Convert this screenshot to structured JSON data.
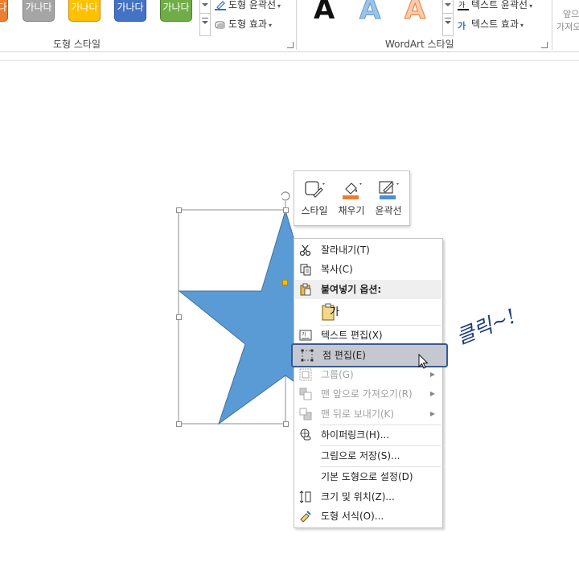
{
  "ribbon": {
    "shape_styles": {
      "swatch_text": "가나다",
      "outline_label": "도형 윤곽선",
      "effects_label": "도형 효과",
      "group_label": "도형 스타일"
    },
    "wordart_styles": {
      "letter": "A",
      "text_outline_label": "텍스트 윤곽선",
      "text_effects_label": "텍스트 효과",
      "group_label": "WordArt 스타일"
    },
    "arrange_partial": {
      "line1": "앞으",
      "line2": "가져오"
    }
  },
  "mini_toolbar": {
    "style": "스타일",
    "fill": "채우기",
    "outline": "윤곽선"
  },
  "context_menu": {
    "cut": "잘라내기(T)",
    "copy": "복사(C)",
    "paste_options_header": "붙여넣기 옵션:",
    "paste_option_glyph": "가",
    "edit_text": "텍스트 편집(X)",
    "edit_points": "점 편집(E)",
    "group": "그룹(G)",
    "bring_to_front": "맨 앞으로 가져오기(R)",
    "send_to_back": "맨 뒤로 보내기(K)",
    "hyperlink": "하이퍼링크(H)...",
    "save_as_picture": "그림으로 저장(S)...",
    "set_default_shape": "기본 도형으로 설정(D)",
    "size_position": "크기 및 위치(Z)...",
    "format_shape": "도형 서식(O)..."
  },
  "annotation": "클릭~!",
  "colors": {
    "star_fill": "#5b9bd5",
    "star_stroke": "#41719c",
    "highlight_border": "#3a5a8e",
    "annotation_ink": "#1f3f7a"
  }
}
